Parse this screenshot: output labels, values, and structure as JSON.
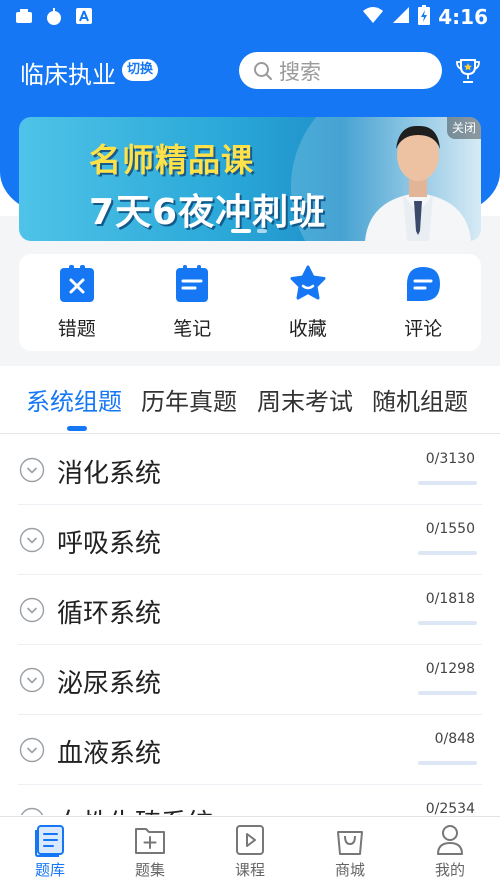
{
  "status_bar": {
    "time": "4:16"
  },
  "header": {
    "subject": "临床执业",
    "switch_label": "切换",
    "search_placeholder": "搜索"
  },
  "banner": {
    "line1": "名师精品课",
    "line2": "7天6夜冲刺班",
    "close_label": "关闭",
    "active_slide": 1,
    "slide_count": 2
  },
  "quick_actions": [
    {
      "label": "错题",
      "icon": "wrong-questions-icon"
    },
    {
      "label": "笔记",
      "icon": "notes-icon"
    },
    {
      "label": "收藏",
      "icon": "favorites-star-icon"
    },
    {
      "label": "评论",
      "icon": "comments-icon"
    }
  ],
  "tabs": [
    {
      "label": "系统组题",
      "active": true
    },
    {
      "label": "历年真题",
      "active": false
    },
    {
      "label": "周末考试",
      "active": false
    },
    {
      "label": "随机组题",
      "active": false
    }
  ],
  "systems": [
    {
      "name": "消化系统",
      "progress": "0/3130",
      "fraction": 0
    },
    {
      "name": "呼吸系统",
      "progress": "0/1550",
      "fraction": 0
    },
    {
      "name": "循环系统",
      "progress": "0/1818",
      "fraction": 0
    },
    {
      "name": "泌尿系统",
      "progress": "0/1298",
      "fraction": 0
    },
    {
      "name": "血液系统",
      "progress": "0/848",
      "fraction": 0
    },
    {
      "name": "女性生殖系统",
      "progress": "0/2534",
      "fraction": 0
    }
  ],
  "bottom_nav": [
    {
      "label": "题库",
      "icon": "question-bank-icon",
      "active": true
    },
    {
      "label": "题集",
      "icon": "question-set-icon",
      "active": false
    },
    {
      "label": "课程",
      "icon": "course-play-icon",
      "active": false
    },
    {
      "label": "商城",
      "icon": "shop-bag-icon",
      "active": false
    },
    {
      "label": "我的",
      "icon": "profile-icon",
      "active": false
    }
  ],
  "colors": {
    "primary": "#1677f5",
    "banner_title": "#ffe24a",
    "background_strip": "#f4f5f7"
  }
}
